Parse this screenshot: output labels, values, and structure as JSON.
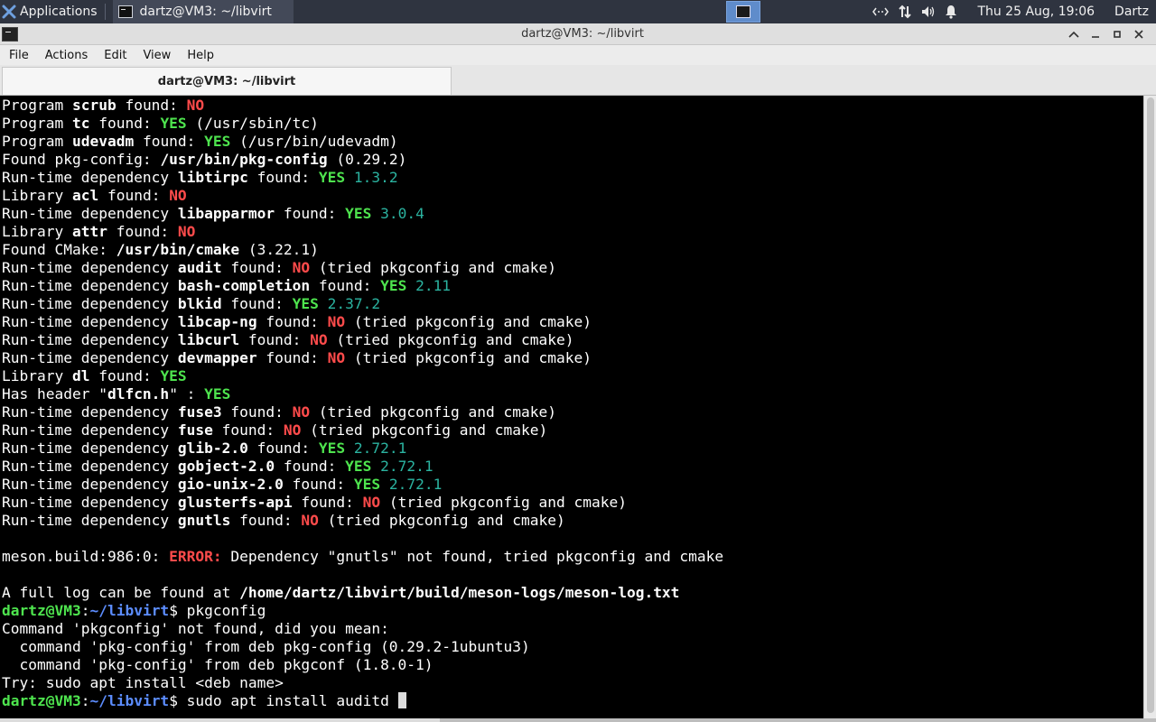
{
  "panel": {
    "applications_label": "Applications",
    "task_label": "dartz@VM3: ~/libvirt",
    "clock": "Thu 25 Aug, 19:06",
    "user": "Dartz"
  },
  "window": {
    "title": "dartz@VM3: ~/libvirt"
  },
  "menu": {
    "file": "File",
    "actions": "Actions",
    "edit": "Edit",
    "view": "View",
    "help": "Help"
  },
  "tab": {
    "label": "dartz@VM3: ~/libvirt"
  },
  "terminal": {
    "lines": [
      [
        {
          "t": "Program "
        },
        {
          "t": "scrub",
          "c": "b"
        },
        {
          "t": " found: "
        },
        {
          "t": "NO",
          "c": "r"
        }
      ],
      [
        {
          "t": "Program "
        },
        {
          "t": "tc",
          "c": "b"
        },
        {
          "t": " found: "
        },
        {
          "t": "YES",
          "c": "g"
        },
        {
          "t": " (/usr/sbin/tc)"
        }
      ],
      [
        {
          "t": "Program "
        },
        {
          "t": "udevadm",
          "c": "b"
        },
        {
          "t": " found: "
        },
        {
          "t": "YES",
          "c": "g"
        },
        {
          "t": " (/usr/bin/udevadm)"
        }
      ],
      [
        {
          "t": "Found pkg-config: "
        },
        {
          "t": "/usr/bin/pkg-config",
          "c": "b"
        },
        {
          "t": " (0.29.2)"
        }
      ],
      [
        {
          "t": "Run-time dependency "
        },
        {
          "t": "libtirpc",
          "c": "b"
        },
        {
          "t": " found: "
        },
        {
          "t": "YES",
          "c": "g"
        },
        {
          "t": " 1.3.2",
          "c": "c"
        }
      ],
      [
        {
          "t": "Library "
        },
        {
          "t": "acl",
          "c": "b"
        },
        {
          "t": " found: "
        },
        {
          "t": "NO",
          "c": "r"
        }
      ],
      [
        {
          "t": "Run-time dependency "
        },
        {
          "t": "libapparmor",
          "c": "b"
        },
        {
          "t": " found: "
        },
        {
          "t": "YES",
          "c": "g"
        },
        {
          "t": " 3.0.4",
          "c": "c"
        }
      ],
      [
        {
          "t": "Library "
        },
        {
          "t": "attr",
          "c": "b"
        },
        {
          "t": " found: "
        },
        {
          "t": "NO",
          "c": "r"
        }
      ],
      [
        {
          "t": "Found CMake: "
        },
        {
          "t": "/usr/bin/cmake",
          "c": "b"
        },
        {
          "t": " (3.22.1)"
        }
      ],
      [
        {
          "t": "Run-time dependency "
        },
        {
          "t": "audit",
          "c": "b"
        },
        {
          "t": " found: "
        },
        {
          "t": "NO",
          "c": "r"
        },
        {
          "t": " (tried pkgconfig and cmake)"
        }
      ],
      [
        {
          "t": "Run-time dependency "
        },
        {
          "t": "bash-completion",
          "c": "b"
        },
        {
          "t": " found: "
        },
        {
          "t": "YES",
          "c": "g"
        },
        {
          "t": " 2.11",
          "c": "c"
        }
      ],
      [
        {
          "t": "Run-time dependency "
        },
        {
          "t": "blkid",
          "c": "b"
        },
        {
          "t": " found: "
        },
        {
          "t": "YES",
          "c": "g"
        },
        {
          "t": " 2.37.2",
          "c": "c"
        }
      ],
      [
        {
          "t": "Run-time dependency "
        },
        {
          "t": "libcap-ng",
          "c": "b"
        },
        {
          "t": " found: "
        },
        {
          "t": "NO",
          "c": "r"
        },
        {
          "t": " (tried pkgconfig and cmake)"
        }
      ],
      [
        {
          "t": "Run-time dependency "
        },
        {
          "t": "libcurl",
          "c": "b"
        },
        {
          "t": " found: "
        },
        {
          "t": "NO",
          "c": "r"
        },
        {
          "t": " (tried pkgconfig and cmake)"
        }
      ],
      [
        {
          "t": "Run-time dependency "
        },
        {
          "t": "devmapper",
          "c": "b"
        },
        {
          "t": " found: "
        },
        {
          "t": "NO",
          "c": "r"
        },
        {
          "t": " (tried pkgconfig and cmake)"
        }
      ],
      [
        {
          "t": "Library "
        },
        {
          "t": "dl",
          "c": "b"
        },
        {
          "t": " found: "
        },
        {
          "t": "YES",
          "c": "g"
        }
      ],
      [
        {
          "t": "Has header \""
        },
        {
          "t": "dlfcn.h",
          "c": "b"
        },
        {
          "t": "\" : "
        },
        {
          "t": "YES",
          "c": "g"
        }
      ],
      [
        {
          "t": "Run-time dependency "
        },
        {
          "t": "fuse3",
          "c": "b"
        },
        {
          "t": " found: "
        },
        {
          "t": "NO",
          "c": "r"
        },
        {
          "t": " (tried pkgconfig and cmake)"
        }
      ],
      [
        {
          "t": "Run-time dependency "
        },
        {
          "t": "fuse",
          "c": "b"
        },
        {
          "t": " found: "
        },
        {
          "t": "NO",
          "c": "r"
        },
        {
          "t": " (tried pkgconfig and cmake)"
        }
      ],
      [
        {
          "t": "Run-time dependency "
        },
        {
          "t": "glib-2.0",
          "c": "b"
        },
        {
          "t": " found: "
        },
        {
          "t": "YES",
          "c": "g"
        },
        {
          "t": " 2.72.1",
          "c": "c"
        }
      ],
      [
        {
          "t": "Run-time dependency "
        },
        {
          "t": "gobject-2.0",
          "c": "b"
        },
        {
          "t": " found: "
        },
        {
          "t": "YES",
          "c": "g"
        },
        {
          "t": " 2.72.1",
          "c": "c"
        }
      ],
      [
        {
          "t": "Run-time dependency "
        },
        {
          "t": "gio-unix-2.0",
          "c": "b"
        },
        {
          "t": " found: "
        },
        {
          "t": "YES",
          "c": "g"
        },
        {
          "t": " 2.72.1",
          "c": "c"
        }
      ],
      [
        {
          "t": "Run-time dependency "
        },
        {
          "t": "glusterfs-api",
          "c": "b"
        },
        {
          "t": " found: "
        },
        {
          "t": "NO",
          "c": "r"
        },
        {
          "t": " (tried pkgconfig and cmake)"
        }
      ],
      [
        {
          "t": "Run-time dependency "
        },
        {
          "t": "gnutls",
          "c": "b"
        },
        {
          "t": " found: "
        },
        {
          "t": "NO",
          "c": "r"
        },
        {
          "t": " (tried pkgconfig and cmake)"
        }
      ],
      [],
      [
        {
          "t": "meson.build:986:0: "
        },
        {
          "t": "ERROR:",
          "c": "r"
        },
        {
          "t": " Dependency \"gnutls\" not found, tried pkgconfig and cmake"
        }
      ],
      [],
      [
        {
          "t": "A full log can be found at "
        },
        {
          "t": "/home/dartz/libvirt/build/meson-logs/meson-log.txt",
          "c": "b"
        }
      ],
      [
        {
          "t": "dartz@VM3",
          "c": "pg"
        },
        {
          "t": ":"
        },
        {
          "t": "~/libvirt",
          "c": "pb"
        },
        {
          "t": "$ pkgconfig"
        }
      ],
      [
        {
          "t": "Command 'pkgconfig' not found, did you mean:"
        }
      ],
      [
        {
          "t": "  command 'pkg-config' from deb pkg-config (0.29.2-1ubuntu3)"
        }
      ],
      [
        {
          "t": "  command 'pkg-config' from deb pkgconf (1.8.0-1)"
        }
      ],
      [
        {
          "t": "Try: sudo apt install <deb name>"
        }
      ],
      [
        {
          "t": "dartz@VM3",
          "c": "pg"
        },
        {
          "t": ":"
        },
        {
          "t": "~/libvirt",
          "c": "pb"
        },
        {
          "t": "$ sudo apt install auditd "
        },
        {
          "cursor": true
        }
      ]
    ]
  }
}
